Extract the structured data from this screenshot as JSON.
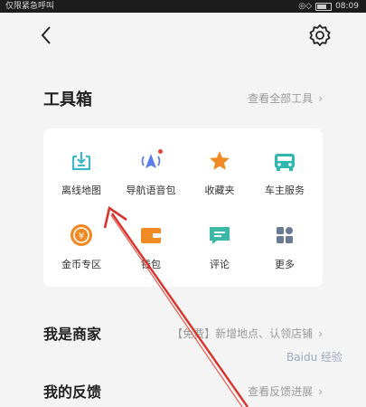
{
  "status_bar": {
    "carrier": "仅限紧急呼叫",
    "time": "08:09"
  },
  "toolbox": {
    "title": "工具箱",
    "view_all": "查看全部工具",
    "tools": [
      {
        "label": "离线地图",
        "icon": "offline-map-icon",
        "color": "#3cb8c6"
      },
      {
        "label": "导航语音包",
        "icon": "voice-pack-icon",
        "color": "#5a7de8"
      },
      {
        "label": "收藏夹",
        "icon": "star-icon",
        "color": "#f08a24"
      },
      {
        "label": "车主服务",
        "icon": "car-icon",
        "color": "#2fb7b0"
      },
      {
        "label": "金币专区",
        "icon": "coin-icon",
        "color": "#f08a24"
      },
      {
        "label": "钱包",
        "icon": "wallet-icon",
        "color": "#f08a24"
      },
      {
        "label": "评论",
        "icon": "comment-icon",
        "color": "#3cb8a6"
      },
      {
        "label": "更多",
        "icon": "more-grid-icon",
        "color": "#6a7a92"
      }
    ]
  },
  "merchant": {
    "title": "我是商家",
    "detail": "【免费】新增地点、认领店铺"
  },
  "feedback": {
    "title": "我的反馈",
    "detail": "查看反馈进展"
  },
  "watermark": "Baidu 经验"
}
